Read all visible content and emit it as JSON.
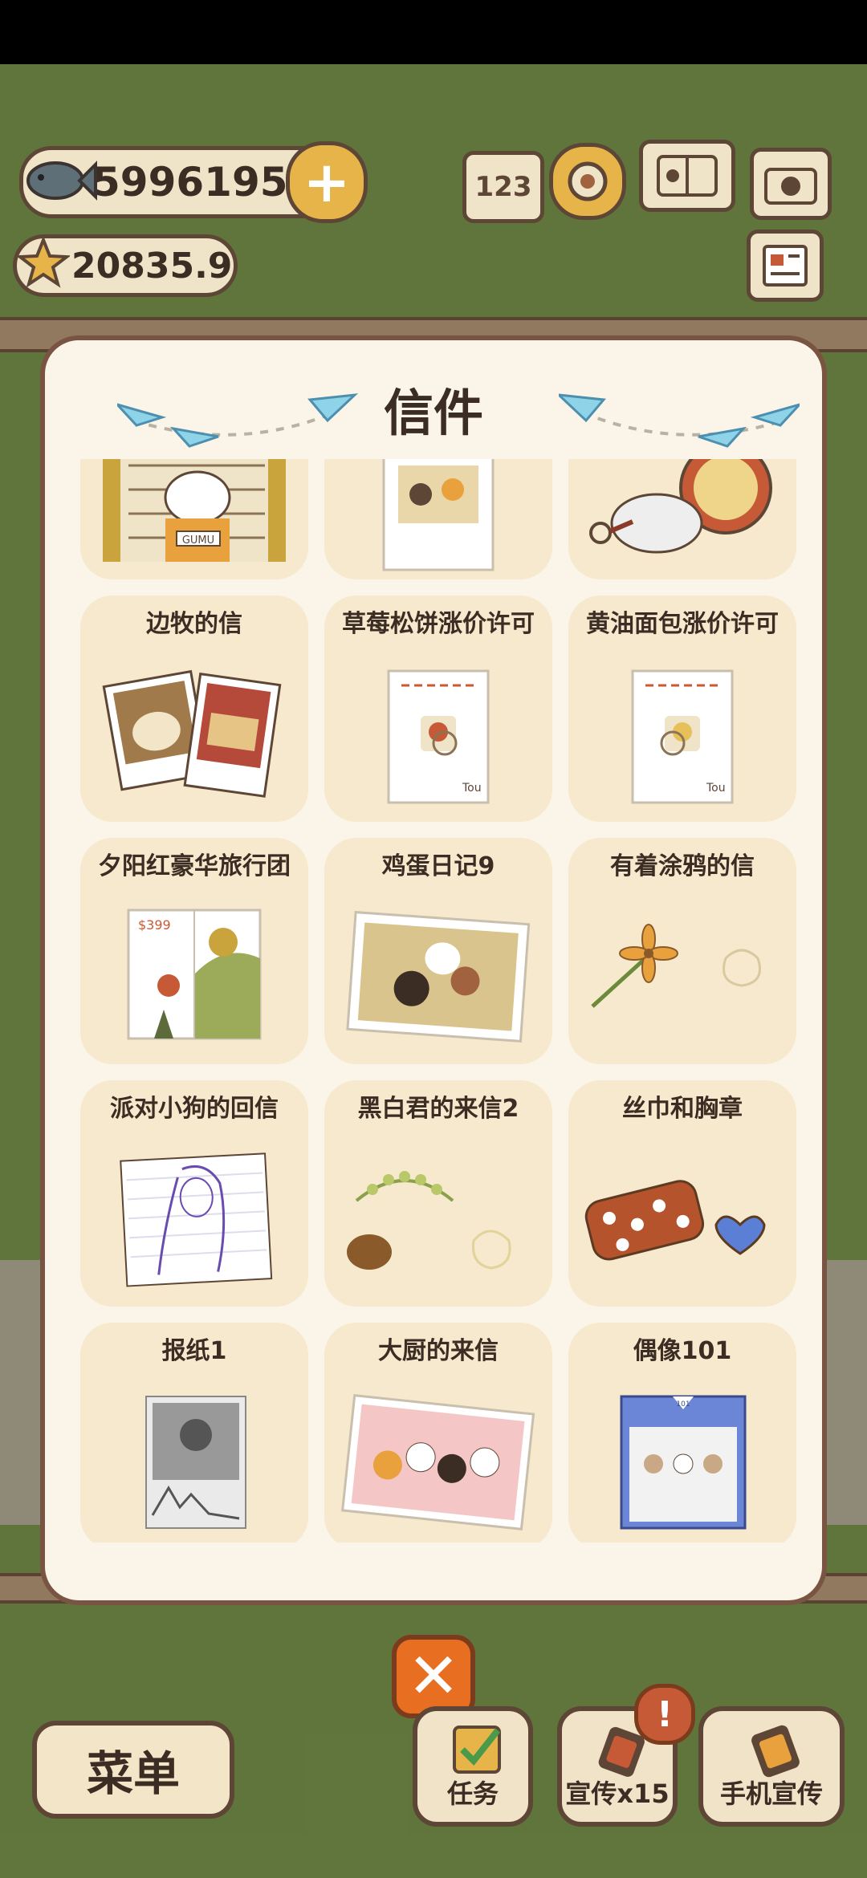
{
  "currency": {
    "fish": "5996195",
    "stars": "20835.9"
  },
  "panel": {
    "title": "信件"
  },
  "letters": [
    {
      "title": ""
    },
    {
      "title": ""
    },
    {
      "title": ""
    },
    {
      "title": "边牧的信"
    },
    {
      "title": "草莓松饼涨价许可"
    },
    {
      "title": "黄油面包涨价许可"
    },
    {
      "title": "夕阳红豪华旅行团"
    },
    {
      "title": "鸡蛋日记9"
    },
    {
      "title": "有着涂鸦的信"
    },
    {
      "title": "派对小狗的回信"
    },
    {
      "title": "黑白君的来信2"
    },
    {
      "title": "丝巾和胸章"
    },
    {
      "title": "报纸1"
    },
    {
      "title": "大厨的来信"
    },
    {
      "title": "偶像101"
    }
  ],
  "illustration_text": {
    "mugshot_sign": "GUMU",
    "travel_price": "$399",
    "note_signature": "Tou",
    "rank_icon": "123",
    "idol_badge": "101"
  },
  "bottom": {
    "menu": "菜单",
    "tasks": "任务",
    "promo": "宣传x15",
    "phone_promo": "手机宣传",
    "badge": "!"
  },
  "icons": [
    "fish-icon",
    "star-icon",
    "plus-icon",
    "ranking-icon",
    "settings-icon",
    "album-icon",
    "camera-icon",
    "news-icon",
    "close-icon",
    "checklist-icon",
    "promo-icon",
    "phone-icon"
  ],
  "colors": {
    "panel_bg": "#fbf4e8",
    "card_bg": "#f6e9cd",
    "border": "#7a5443",
    "close": "#e86f22",
    "grass": "#86a353"
  }
}
